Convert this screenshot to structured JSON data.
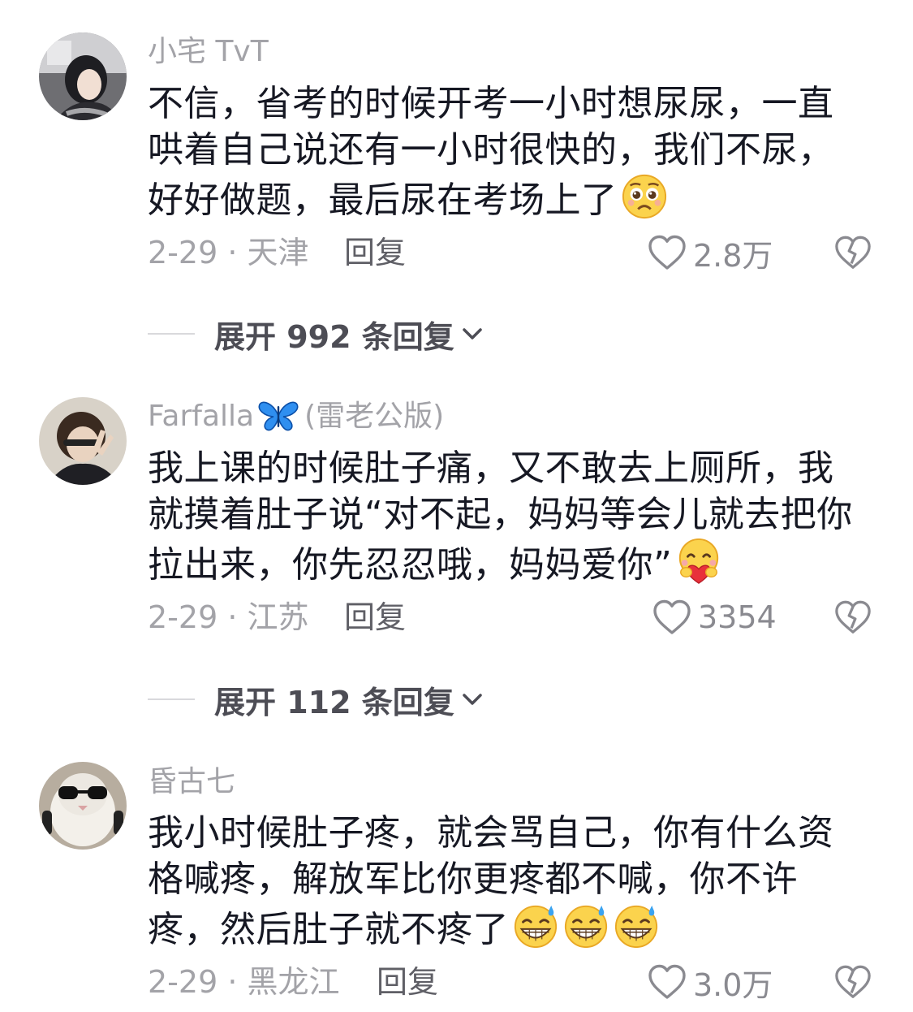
{
  "comments": [
    {
      "username": "小宅 TvT",
      "username_suffix": "",
      "lines": [
        "不信，省考的时候开考一小时想尿尿，一直",
        "哄着自己说还有一小时很快的，我们不尿，",
        "好好做题，最后尿在考场上了"
      ],
      "emoji": "pleading-face",
      "date_location": "2-29 · 天津",
      "reply_label": "回复",
      "likes": "2.8万",
      "expand_label": "展开 992 条回复"
    },
    {
      "username": "Farfalla",
      "username_suffix": "(雷老公版)",
      "lines": [
        "我上课的时候肚子痛，又不敢去上厕所，我",
        "就摸着肚子说“对不起，妈妈等会儿就去把你",
        "拉出来，你先忍忍哦，妈妈爱你”"
      ],
      "emoji": "smiling-face-with-heart",
      "date_location": "2-29 · 江苏",
      "reply_label": "回复",
      "likes": "3354",
      "expand_label": "展开 112 条回复"
    },
    {
      "username": "昏古七",
      "username_suffix": "",
      "lines": [
        "我小时候肚子疼，就会骂自己，你有什么资",
        "格喊疼，解放军比你更疼都不喊，你不许",
        "疼，然后肚子就不疼了"
      ],
      "emoji": "grinning-sweat",
      "date_location": "2-29 · 黑龙江",
      "reply_label": "回复",
      "likes": "3.0万",
      "expand_label": ""
    }
  ],
  "colors": {
    "text_primary": "#161823",
    "text_secondary": "#a3a3a8",
    "reply": "#5f5f66",
    "butterfly": "#2f8ff0"
  }
}
